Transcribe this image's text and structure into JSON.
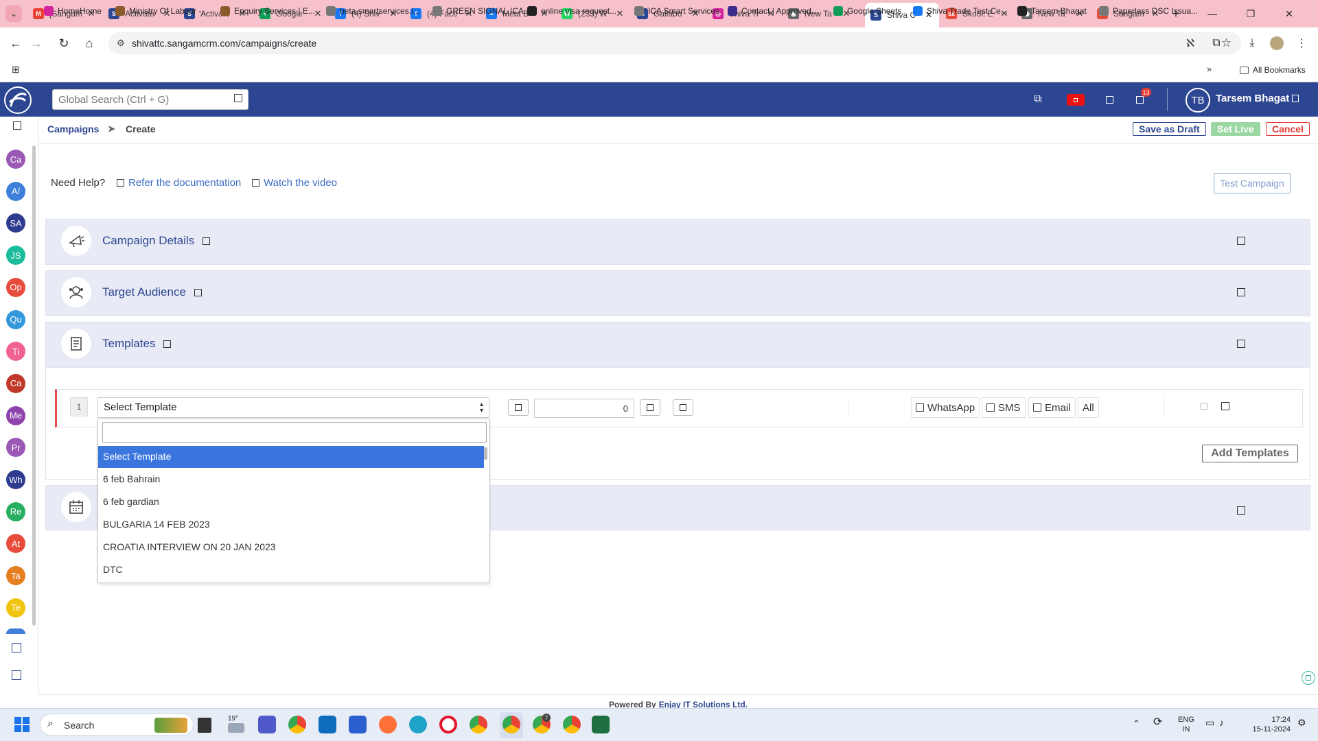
{
  "browser": {
    "tabs": [
      {
        "title": "[Sangam",
        "color": "#ea4335",
        "glyph": "M"
      },
      {
        "title": "Activate",
        "color": "#2d4692",
        "glyph": "S"
      },
      {
        "title": "Activate",
        "color": "#2d4692",
        "glyph": "S"
      },
      {
        "title": "Google",
        "color": "#0f9d58",
        "glyph": "+"
      },
      {
        "title": "(4) Shiv",
        "color": "#1877f2",
        "glyph": "f"
      },
      {
        "title": "(4) Face",
        "color": "#1877f2",
        "glyph": "f"
      },
      {
        "title": "Meta B",
        "color": "#1877f2",
        "glyph": "∞"
      },
      {
        "title": "(233) W",
        "color": "#25d366",
        "glyph": "W"
      },
      {
        "title": "Gallabo",
        "color": "#2d4692",
        "glyph": "S"
      },
      {
        "title": "Shiva Tr",
        "color": "#d6249f",
        "glyph": "◎"
      },
      {
        "title": "New Ta",
        "color": "#666666",
        "glyph": "◉"
      },
      {
        "title": "Shiva C",
        "color": "#2d4692",
        "glyph": "S"
      },
      {
        "title": "Skool: E",
        "color": "#e74c3c",
        "glyph": "sk"
      },
      {
        "title": "New Ta",
        "color": "#666666",
        "glyph": "◉"
      },
      {
        "title": "Sangam",
        "color": "#e74c3c",
        "glyph": "sk"
      }
    ],
    "url": "shivattc.sangamcrm.com/campaigns/create",
    "bookmarks": [
      {
        "label": "HomeHome",
        "color": "#d6249f"
      },
      {
        "label": "Ministry Of Labour -...",
        "color": "#8b5a2b"
      },
      {
        "label": "Enquiry Services | E...",
        "color": "#8b5a2b"
      },
      {
        "label": "beta.smartservices.i...",
        "color": "#777777"
      },
      {
        "label": "GREEN SIGNAL ICA",
        "color": "#777777"
      },
      {
        "label": "online visa request...",
        "color": "#222222"
      },
      {
        "label": "ICA Smart Services",
        "color": "#777777"
      },
      {
        "label": "Contact | Approved...",
        "color": "#3b2c8f"
      },
      {
        "label": "Google Sheets",
        "color": "#0f9d58"
      },
      {
        "label": "Shiva Trade Test Ce...",
        "color": "#1877f2"
      },
      {
        "label": "Tarsem Bhagat",
        "color": "#222222"
      },
      {
        "label": "Paperless DSC Issua...",
        "color": "#777777"
      }
    ],
    "all_bookmarks": "All Bookmarks"
  },
  "header": {
    "search_placeholder": "Global Search (Ctrl + G)",
    "notification_count": "13",
    "avatar_initials": "TB",
    "user_name": "Tarsem Bhagat"
  },
  "rail": [
    {
      "label": "Ca",
      "color": "#9b59b6"
    },
    {
      "label": "A/",
      "color": "#3d7fd9"
    },
    {
      "label": "SA",
      "color": "#2d3c8f"
    },
    {
      "label": "JS",
      "color": "#1abc9c"
    },
    {
      "label": "Op",
      "color": "#e74c3c"
    },
    {
      "label": "Qu",
      "color": "#3498db"
    },
    {
      "label": "Ti",
      "color": "#f06292"
    },
    {
      "label": "Ca",
      "color": "#c0392b"
    },
    {
      "label": "Me",
      "color": "#8e44ad"
    },
    {
      "label": "Pr",
      "color": "#9b59b6"
    },
    {
      "label": "Wh",
      "color": "#2d3c8f"
    },
    {
      "label": "Re",
      "color": "#27ae60"
    },
    {
      "label": "At",
      "color": "#e74c3c"
    },
    {
      "label": "Ta",
      "color": "#e67e22"
    },
    {
      "label": "Te",
      "color": "#f1c40f"
    }
  ],
  "breadcrumb": {
    "root": "Campaigns",
    "sep": "➤",
    "current": "Create"
  },
  "actions": {
    "save_draft": "Save as Draft",
    "set_live": "Set Live",
    "cancel": "Cancel",
    "test_campaign": "Test Campaign"
  },
  "help": {
    "label": "Need Help?",
    "doc_link": "Refer the documentation",
    "video_link": "Watch the video"
  },
  "sections": {
    "campaign_details": "Campaign Details",
    "target_audience": "Target Audience",
    "templates": "Templates"
  },
  "template_row": {
    "index": "1",
    "select_value": "Select Template",
    "quantity": "0",
    "channels": [
      "WhatsApp",
      "SMS",
      "Email",
      "All"
    ]
  },
  "dropdown": {
    "options": [
      "Select Template",
      "6 feb Bahrain",
      "6 feb gardian",
      "BULGARIA 14 FEB 2023",
      "CROATIA INTERVIEW ON 20 JAN 2023",
      "DTC"
    ],
    "selected_index": 0
  },
  "add_templates": "Add Templates",
  "footer": {
    "prefix": "Powered By",
    "company": "Enjay IT Solutions Ltd."
  },
  "taskbar": {
    "search": "Search",
    "weather": "19°",
    "badge": "7",
    "lang": "ENG",
    "region": "IN",
    "time": "17:24",
    "date": "15-11-2024"
  }
}
